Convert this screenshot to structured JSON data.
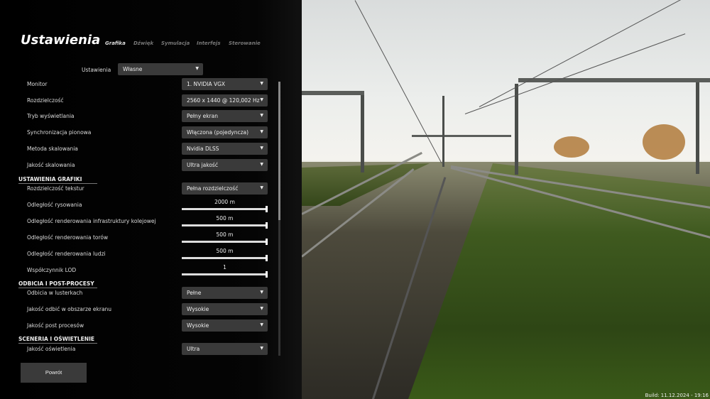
{
  "title": "Ustawienia",
  "tabs": [
    {
      "label": "Grafika",
      "active": true
    },
    {
      "label": "Dźwięk"
    },
    {
      "label": "Symulacja"
    },
    {
      "label": "Interfejs"
    },
    {
      "label": "Sterowanie"
    }
  ],
  "preset": {
    "label": "Ustawienia",
    "value": "Własne"
  },
  "rows": [
    {
      "type": "dropdown",
      "label": "Monitor",
      "value": "1. NVIDIA VGX"
    },
    {
      "type": "dropdown",
      "label": "Rozdzielczość",
      "value": "2560 x 1440 @ 120,002 Hz"
    },
    {
      "type": "dropdown",
      "label": "Tryb wyświetlania",
      "value": "Pełny ekran"
    },
    {
      "type": "dropdown",
      "label": "Synchronizacja pionowa",
      "value": "Włączona (pojedyncza)"
    },
    {
      "type": "dropdown",
      "label": "Metoda skalowania",
      "value": "Nvidia DLSS"
    },
    {
      "type": "dropdown",
      "label": "Jakość skalowania",
      "value": "Ultra jakość"
    },
    {
      "type": "header",
      "label": "USTAWIENIA GRAFIKI"
    },
    {
      "type": "dropdown",
      "label": "Rozdzielczość tekstur",
      "value": "Pełna rozdzielczość"
    },
    {
      "type": "slider",
      "label": "Odległość rysowania",
      "value": "2000 m",
      "fraction": 1
    },
    {
      "type": "slider",
      "label": "Odległość renderowania infrastruktury kolejowej",
      "value": "500 m",
      "fraction": 1
    },
    {
      "type": "slider",
      "label": "Odległość renderowania torów",
      "value": "500 m",
      "fraction": 1
    },
    {
      "type": "slider",
      "label": "Odległość renderowania ludzi",
      "value": "500 m",
      "fraction": 1
    },
    {
      "type": "slider",
      "label": "Współczynnik LOD",
      "value": "1",
      "fraction": 1
    },
    {
      "type": "header",
      "label": "ODBICIA I POST-PROCESY"
    },
    {
      "type": "dropdown",
      "label": "Odbicia w lusterkach",
      "value": "Pełne"
    },
    {
      "type": "dropdown",
      "label": "Jakość odbić w obszarze ekranu",
      "value": "Wysokie"
    },
    {
      "type": "dropdown",
      "label": "Jakość post procesów",
      "value": "Wysokie"
    },
    {
      "type": "header",
      "label": "SCENERIA I OŚWIETLENIE"
    },
    {
      "type": "dropdown",
      "label": "Jakość oświetlenia",
      "value": "Ultra"
    }
  ],
  "scrollbar": {
    "position_fraction": 0
  },
  "back_label": "Powrót",
  "build": "Build: 11.12.2024 - 19:16",
  "icons": {
    "dropdown": "caret-down-icon"
  }
}
